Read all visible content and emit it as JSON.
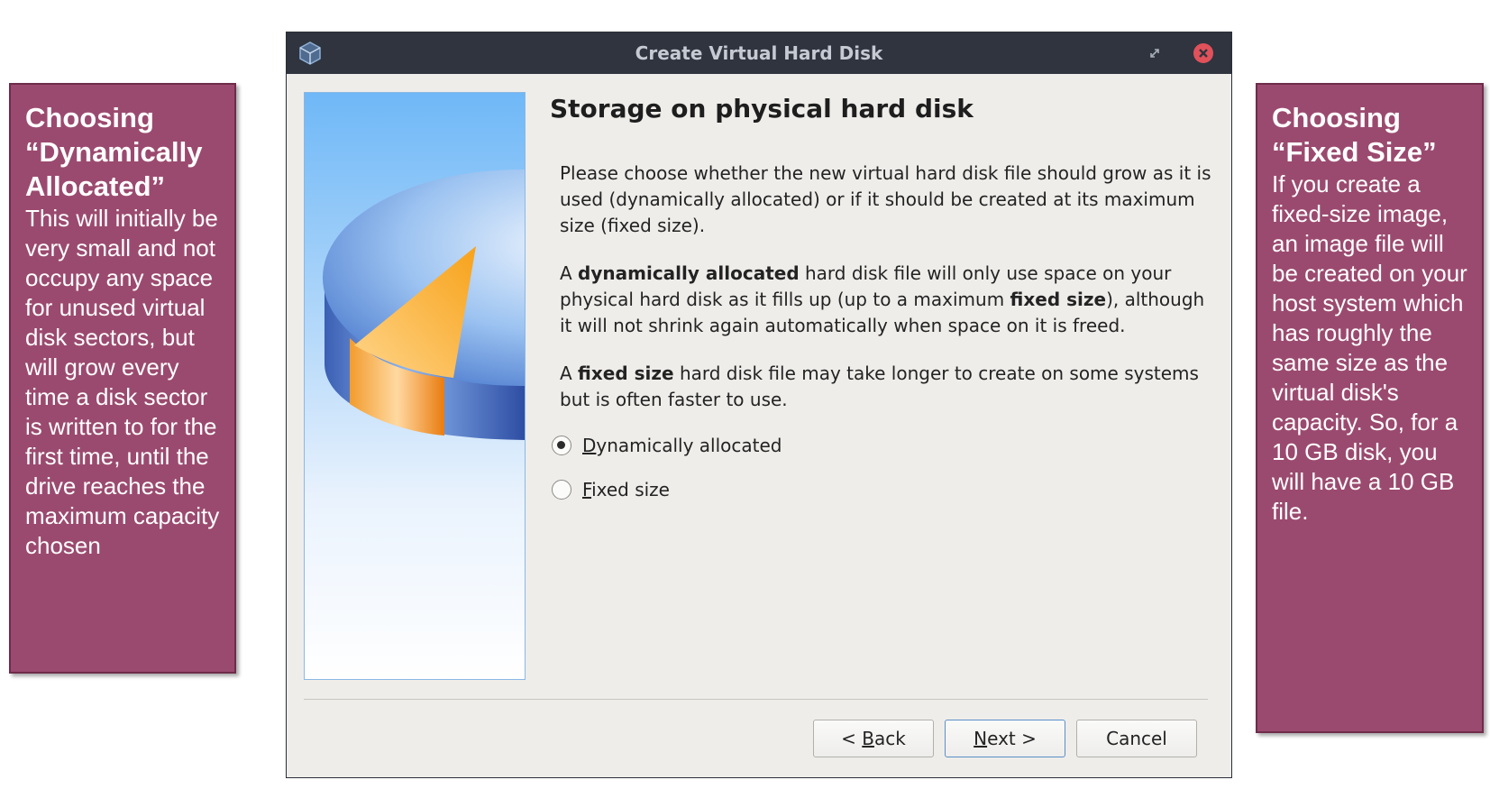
{
  "callouts": {
    "left": {
      "title": "Choosing “Dynamically Allocated”",
      "body": "This will initially be very small and not occupy any space for unused virtual disk sectors, but will grow every time a disk sector is written to for the first time, until the drive reaches the maximum capacity chosen"
    },
    "right": {
      "title": "Choosing “Fixed Size”",
      "body": "If you create a fixed-size image, an image file will be created on your host system which has roughly the same size as the virtual disk's capacity. So, for a 10 GB disk, you will have a 10 GB file."
    }
  },
  "dialog": {
    "title": "Create Virtual Hard Disk",
    "heading": "Storage on physical hard disk",
    "paragraph1": "Please choose whether the new virtual hard disk file should grow as it is used (dynamically allocated) or if it should be created at its maximum size (fixed size).",
    "paragraph2": {
      "a": "A ",
      "b1": "dynamically allocated",
      "c": " hard disk file will only use space on your physical hard disk as it fills up (up to a maximum ",
      "b2": "fixed size",
      "d": "), although it will not shrink again automatically when space on it is freed."
    },
    "paragraph3": {
      "a": "A ",
      "b1": "fixed size",
      "c": " hard disk file may take longer to create on some systems but is often faster to use."
    },
    "options": [
      {
        "mnemonic": "D",
        "rest": "ynamically allocated",
        "selected": true
      },
      {
        "mnemonic": "F",
        "rest": "ixed size",
        "selected": false
      }
    ],
    "buttons": {
      "back": {
        "pre": "< ",
        "mnemonic": "B",
        "rest": "ack"
      },
      "next": {
        "mnemonic": "N",
        "rest": "ext >"
      },
      "cancel": "Cancel"
    }
  },
  "colors": {
    "callout_bg": "#9b4a6f",
    "titlebar_bg": "#2f343f",
    "close_red": "#e0515a",
    "dialog_bg": "#efedea"
  },
  "icons": [
    "virtualbox-icon",
    "restore-icon",
    "close-icon",
    "hard-disk-pie-icon"
  ]
}
